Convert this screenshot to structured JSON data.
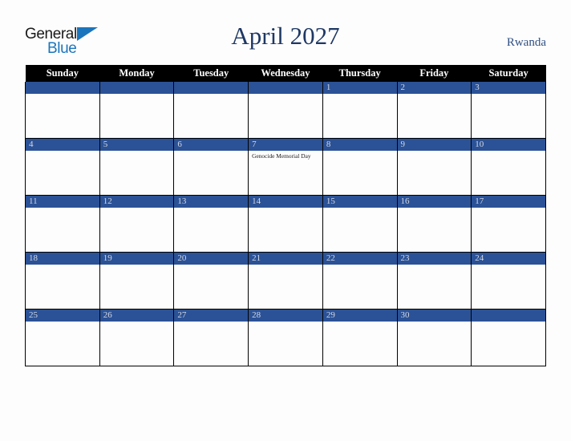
{
  "header": {
    "logo": {
      "word1": "General",
      "word2": "Blue",
      "triangle_color": "#1b75bc",
      "word1_color": "#1a1a1a"
    },
    "title": "April 2027",
    "country": "Rwanda",
    "title_color": "#1f3864",
    "country_color": "#2f4f82"
  },
  "calendar": {
    "month": "April",
    "year": "2027",
    "accent_color": "#2b5296",
    "header_bg": "#000000",
    "header_text_color": "#ffffff",
    "date_text_color": "#d4d9e6",
    "weekdays": [
      "Sunday",
      "Monday",
      "Tuesday",
      "Wednesday",
      "Thursday",
      "Friday",
      "Saturday"
    ],
    "weeks": [
      [
        {
          "date": "",
          "events": []
        },
        {
          "date": "",
          "events": []
        },
        {
          "date": "",
          "events": []
        },
        {
          "date": "",
          "events": []
        },
        {
          "date": "1",
          "events": []
        },
        {
          "date": "2",
          "events": []
        },
        {
          "date": "3",
          "events": []
        }
      ],
      [
        {
          "date": "4",
          "events": []
        },
        {
          "date": "5",
          "events": []
        },
        {
          "date": "6",
          "events": []
        },
        {
          "date": "7",
          "events": [
            "Genocide Memorial Day"
          ]
        },
        {
          "date": "8",
          "events": []
        },
        {
          "date": "9",
          "events": []
        },
        {
          "date": "10",
          "events": []
        }
      ],
      [
        {
          "date": "11",
          "events": []
        },
        {
          "date": "12",
          "events": []
        },
        {
          "date": "13",
          "events": []
        },
        {
          "date": "14",
          "events": []
        },
        {
          "date": "15",
          "events": []
        },
        {
          "date": "16",
          "events": []
        },
        {
          "date": "17",
          "events": []
        }
      ],
      [
        {
          "date": "18",
          "events": []
        },
        {
          "date": "19",
          "events": []
        },
        {
          "date": "20",
          "events": []
        },
        {
          "date": "21",
          "events": []
        },
        {
          "date": "22",
          "events": []
        },
        {
          "date": "23",
          "events": []
        },
        {
          "date": "24",
          "events": []
        }
      ],
      [
        {
          "date": "25",
          "events": []
        },
        {
          "date": "26",
          "events": []
        },
        {
          "date": "27",
          "events": []
        },
        {
          "date": "28",
          "events": []
        },
        {
          "date": "29",
          "events": []
        },
        {
          "date": "30",
          "events": []
        },
        {
          "date": "",
          "events": []
        }
      ]
    ]
  }
}
